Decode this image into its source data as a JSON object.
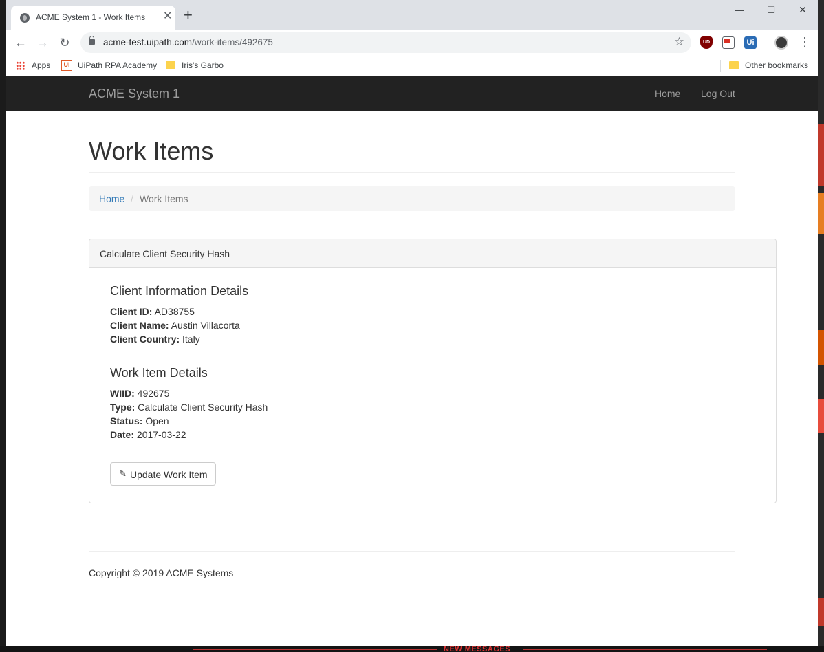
{
  "browser": {
    "tab_title": "ACME System 1 - Work Items",
    "tab_close": "✕",
    "new_tab": "+",
    "url_host": "acme-test.uipath.com",
    "url_path": "/work-items/492675",
    "back": "←",
    "forward": "→",
    "reload": "↻",
    "star": "☆",
    "menu": "⋮",
    "window_controls": {
      "minimize": "—",
      "maximize": "☐",
      "close": "✕"
    },
    "extensions": [
      {
        "name": "ublock-icon",
        "label": "UD"
      },
      {
        "name": "cast-icon",
        "label": ""
      },
      {
        "name": "uipath-icon",
        "label": "Ui"
      }
    ]
  },
  "bookmarks": {
    "apps": "Apps",
    "uipath": "UiPath RPA Academy",
    "iris": "Iris's Garbo",
    "other": "Other bookmarks",
    "ui_glyph": "Ui"
  },
  "app": {
    "brand": "ACME System 1",
    "nav": {
      "home": "Home",
      "logout": "Log Out"
    },
    "page_title": "Work Items",
    "breadcrumb": {
      "home": "Home",
      "sep": "/",
      "current": "Work Items"
    },
    "panel_title": "Calculate Client Security Hash",
    "client_section": "Client Information Details",
    "client": {
      "id_label": "Client ID:",
      "id": "AD38755",
      "name_label": "Client Name:",
      "name": "Austin Villacorta",
      "country_label": "Client Country:",
      "country": "Italy"
    },
    "work_section": "Work Item Details",
    "work": {
      "wiid_label": "WIID:",
      "wiid": "492675",
      "type_label": "Type:",
      "type": "Calculate Client Security Hash",
      "status_label": "Status:",
      "status": "Open",
      "date_label": "Date:",
      "date": "2017-03-22"
    },
    "update_button": "Update Work Item",
    "pencil_glyph": "✎",
    "footer": "Copyright © 2019 ACME Systems"
  },
  "desktop": {
    "banner": "NEW MESSAGES"
  },
  "colors": {
    "navbar": "#222222",
    "link": "#337ab7",
    "muted": "#9d9d9d"
  }
}
